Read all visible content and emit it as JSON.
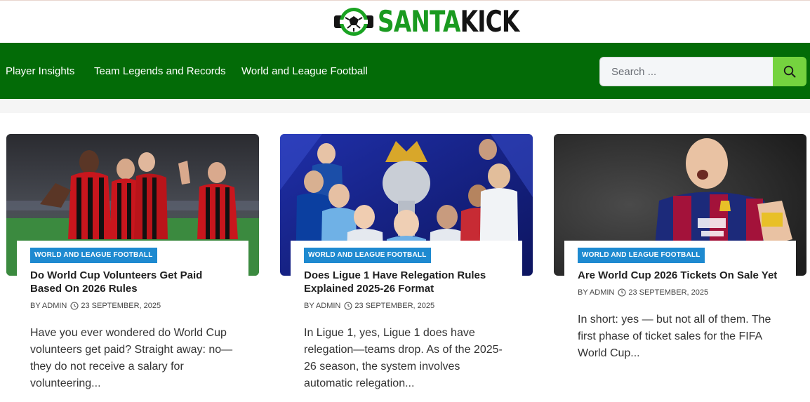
{
  "site": {
    "logo_part1": "SANTA",
    "logo_part2": "KICK",
    "brand_color": "#036b07",
    "accent_color": "#75d33f",
    "category_color": "#1e8ad0"
  },
  "nav": {
    "items": [
      {
        "label": "Player Insights"
      },
      {
        "label": "Team Legends and Records"
      },
      {
        "label": "World and League Football"
      }
    ]
  },
  "search": {
    "placeholder": "Search ...",
    "icon": "search-icon"
  },
  "posts": [
    {
      "category": "WORLD AND LEAGUE FOOTBALL",
      "title": "Do World Cup Volunteers Get Paid Based On 2026 Rules",
      "author": "BY ADMIN",
      "date": "23 SEPTEMBER, 2025",
      "excerpt": "Have you ever wondered do World Cup volunteers get paid? Straight away: no—they do not receive a salary for volunteering...",
      "image": "ac-milan-players-celebrating"
    },
    {
      "category": "WORLD AND LEAGUE FOOTBALL",
      "title": "Does Ligue 1 Have Relegation Rules Explained 2025-26 Format",
      "author": "BY ADMIN",
      "date": "23 SEPTEMBER, 2025",
      "excerpt": "In Ligue 1, yes, Ligue 1 does have relegation—teams drop. As of the 2025-26 season, the system involves automatic relegation...",
      "image": "premier-league-trophy-players"
    },
    {
      "category": "WORLD AND LEAGUE FOOTBALL",
      "title": "Are World Cup 2026 Tickets On Sale Yet",
      "author": "BY ADMIN",
      "date": "23 SEPTEMBER, 2025",
      "excerpt": "In short: yes — but not all of them. The first phase of ticket sales for the FIFA World Cup...",
      "image": "barcelona-player-shouting"
    }
  ]
}
